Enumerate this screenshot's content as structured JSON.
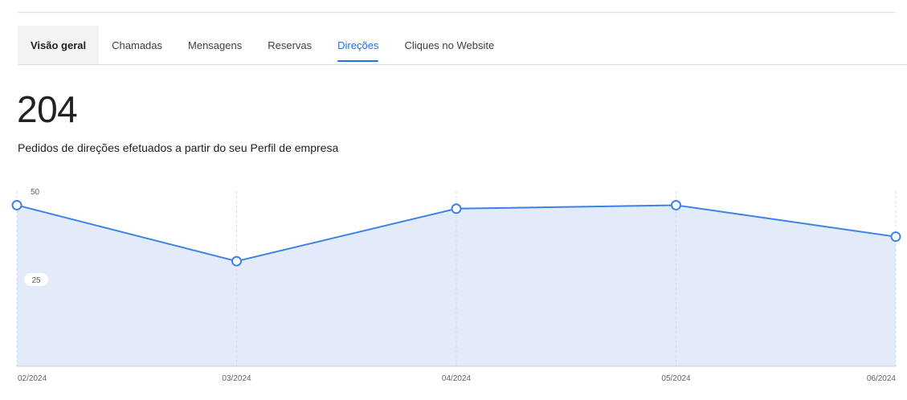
{
  "tabs": [
    {
      "label": "Visão geral",
      "state": "overview"
    },
    {
      "label": "Chamadas",
      "state": "normal"
    },
    {
      "label": "Mensagens",
      "state": "normal"
    },
    {
      "label": "Reservas",
      "state": "normal"
    },
    {
      "label": "Direções",
      "state": "active"
    },
    {
      "label": "Cliques no Website",
      "state": "normal"
    }
  ],
  "summary": {
    "value": "204",
    "caption": "Pedidos de direções efetuados a partir do seu Perfil de empresa"
  },
  "colors": {
    "accent": "#1a73e8",
    "line": "#3b82e6",
    "fill": "#e3ebfb"
  },
  "chart_data": {
    "type": "area",
    "x": [
      "02/2024",
      "03/2024",
      "04/2024",
      "05/2024",
      "06/2024"
    ],
    "series": [
      {
        "values": [
          46,
          30,
          45,
          46,
          37
        ]
      }
    ],
    "yticks": [
      50,
      25
    ],
    "ylim": [
      0,
      50
    ],
    "xlabel": "",
    "ylabel": "",
    "grid": "vertical-dashed"
  }
}
